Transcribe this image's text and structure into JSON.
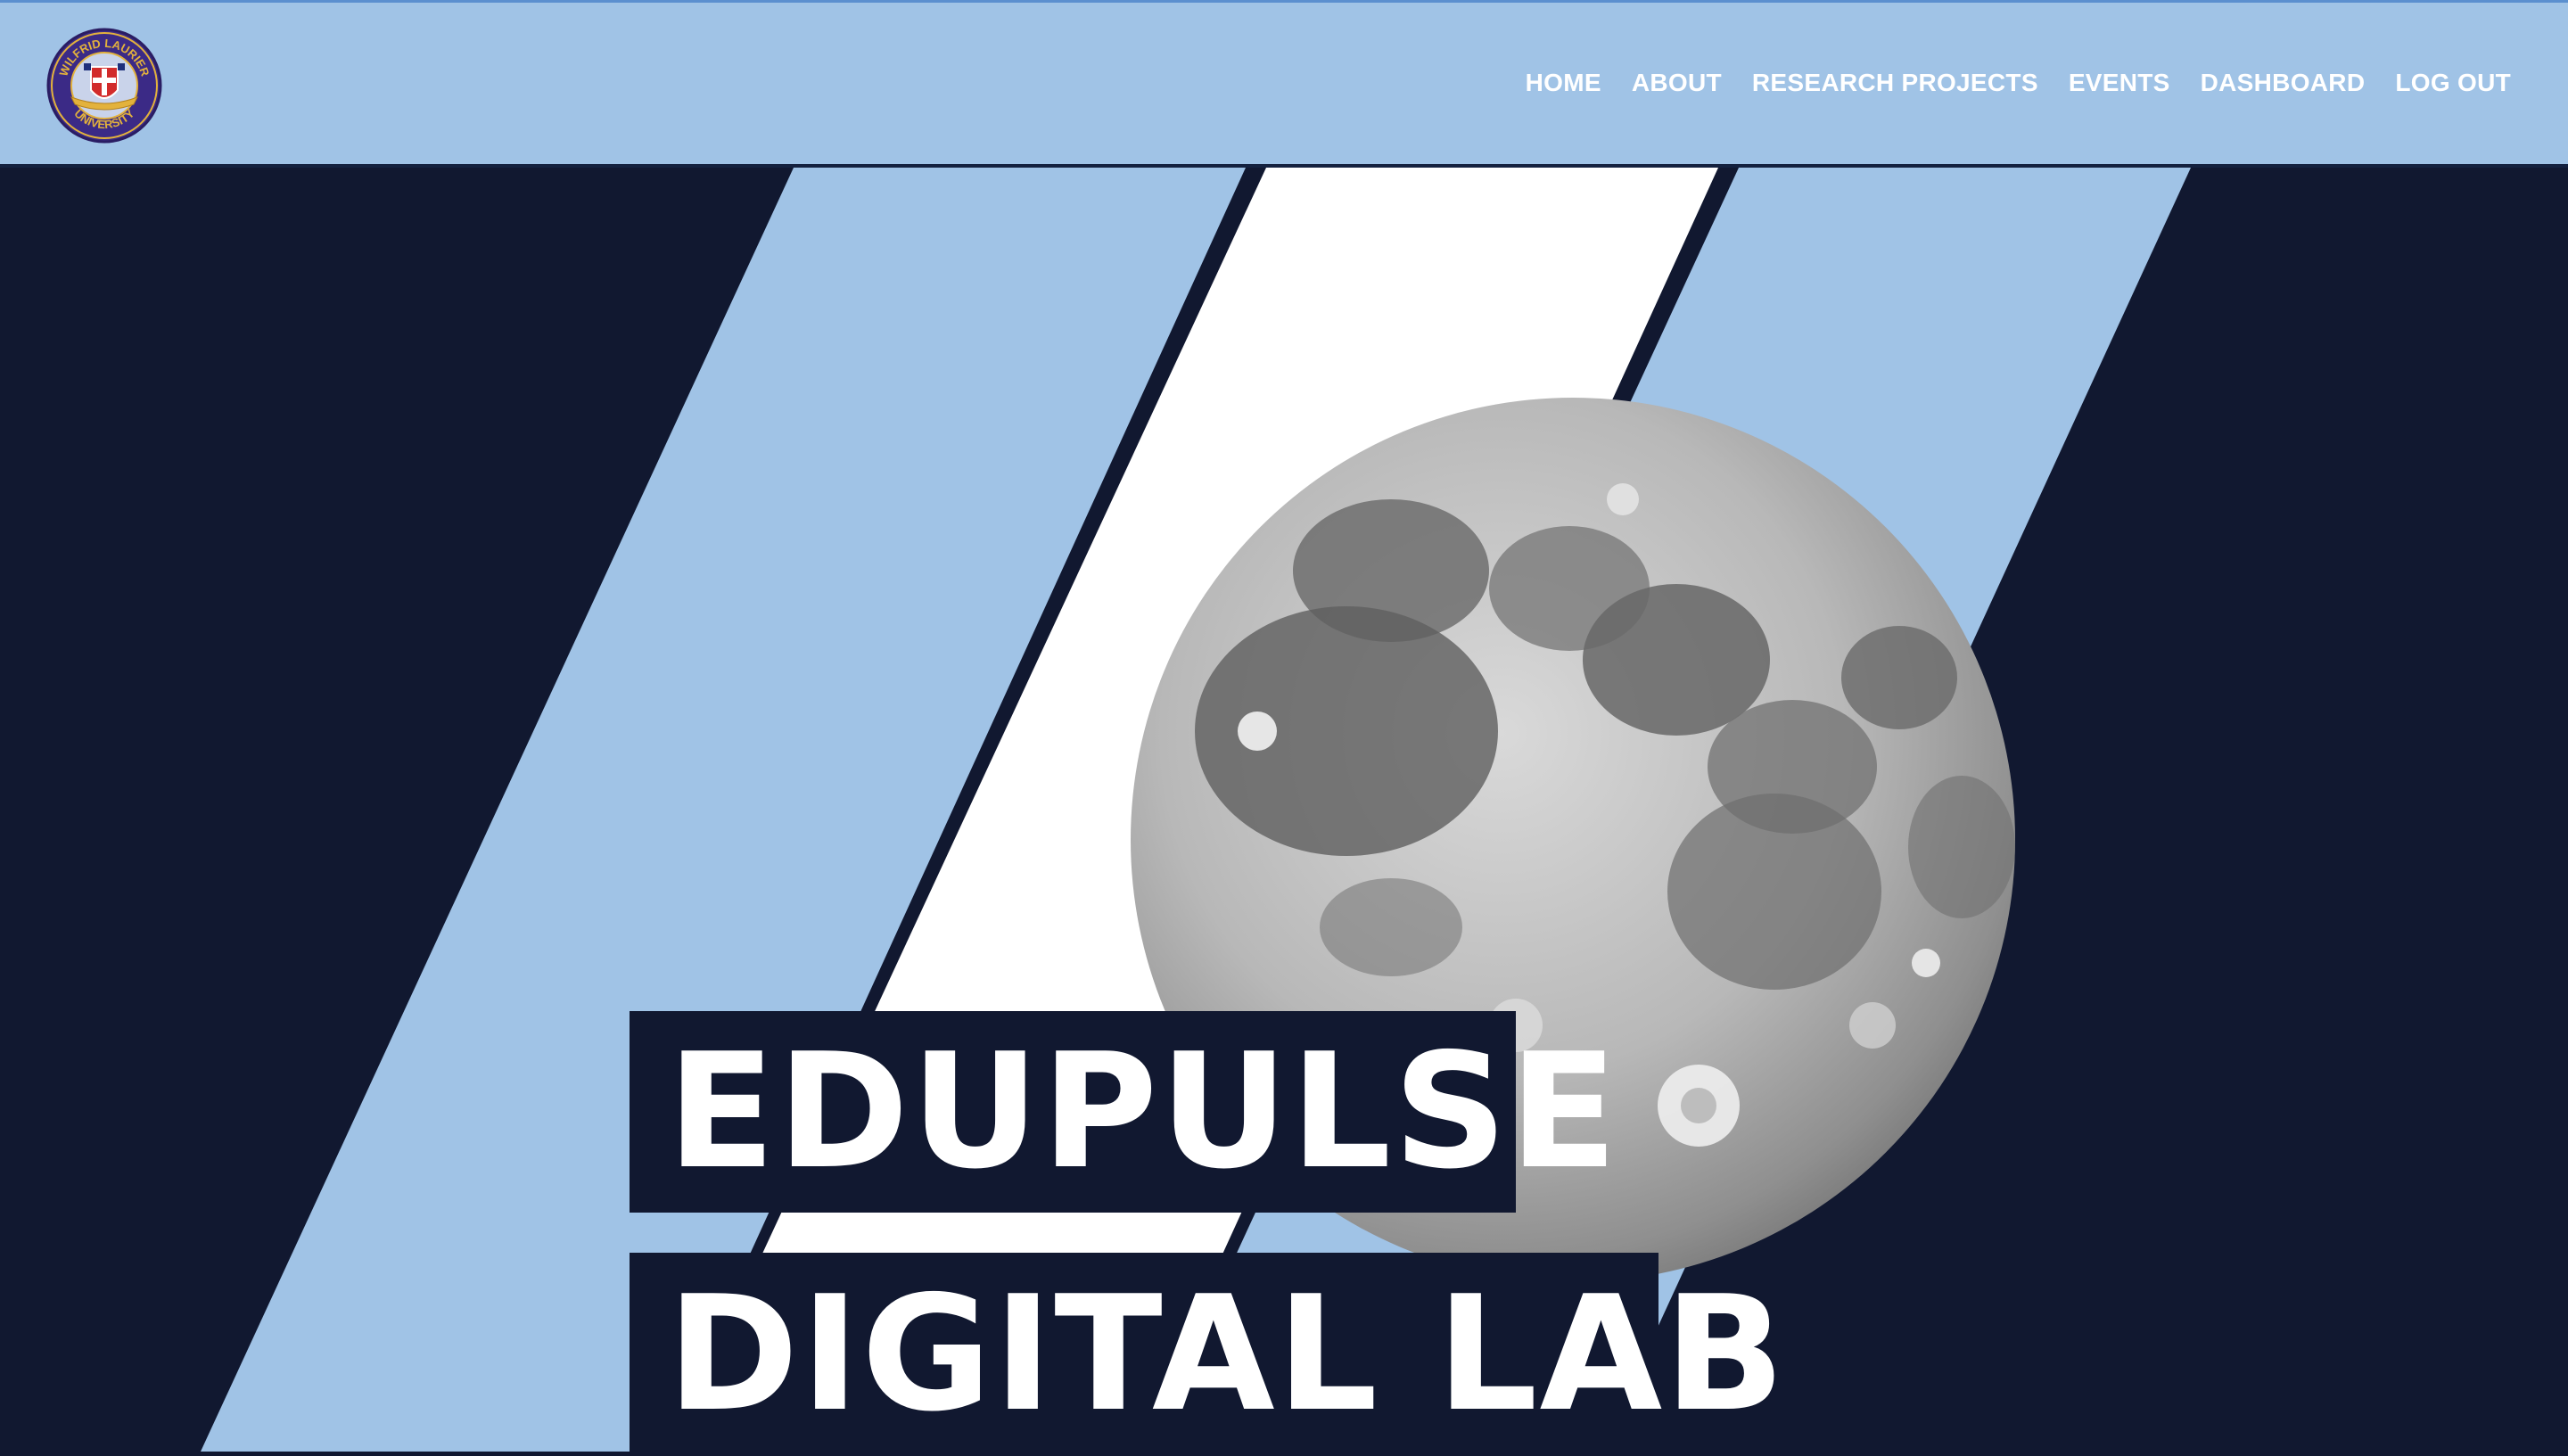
{
  "header": {
    "logo": {
      "icon": "university-seal-icon",
      "text_top": "WILFRID LAURIER",
      "text_bottom": "UNIVERSITY"
    },
    "nav": [
      {
        "label": "HOME"
      },
      {
        "label": "ABOUT"
      },
      {
        "label": "RESEARCH PROJECTS"
      },
      {
        "label": "EVENTS"
      },
      {
        "label": "DASHBOARD"
      },
      {
        "label": "LOG OUT"
      }
    ]
  },
  "hero": {
    "title_line1": "EDUPULSE",
    "title_line2": "DIGITAL LAB",
    "image": "full-moon-image"
  },
  "colors": {
    "header_bg": "#a0c3e6",
    "navy": "#111830",
    "light_blue": "#a0c3e6",
    "white": "#ffffff",
    "seal_purple": "#3b2a86",
    "seal_gold": "#e3b23c",
    "seal_red": "#d22b2b"
  }
}
